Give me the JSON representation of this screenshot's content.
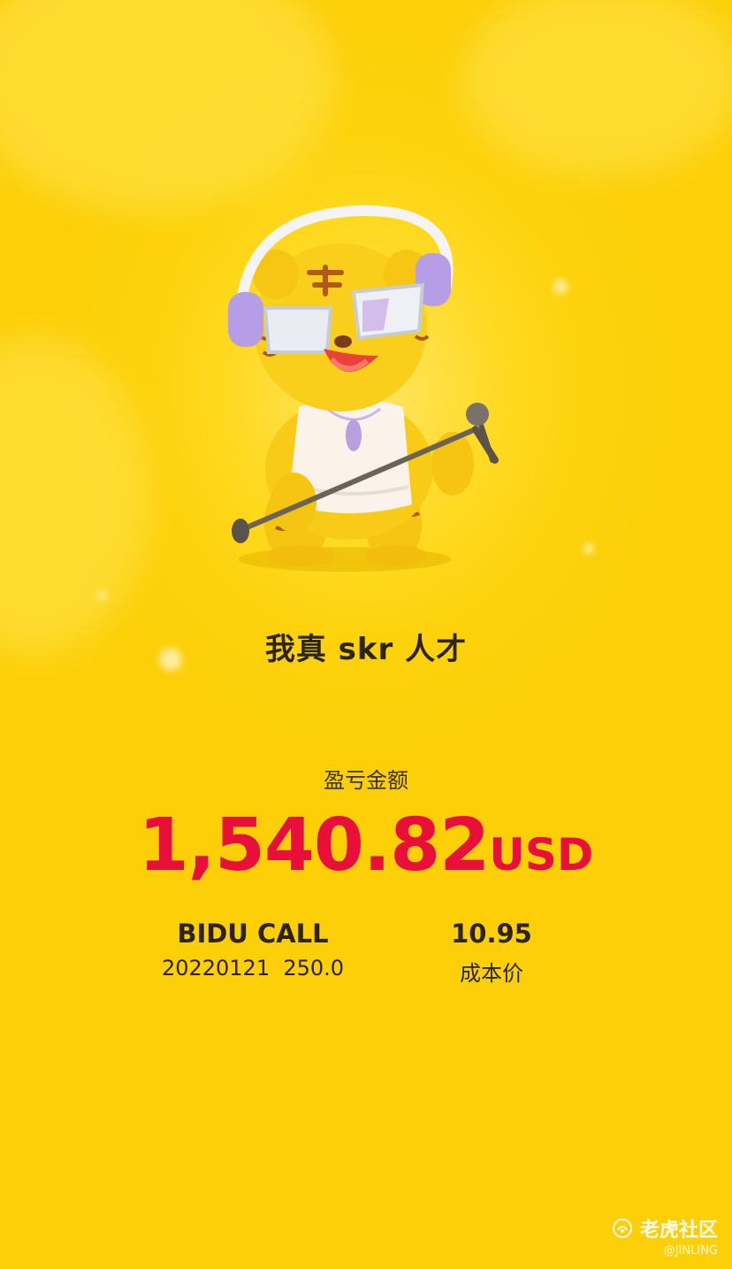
{
  "background": {
    "color": "#fdd20c"
  },
  "mascot": {
    "icon": "tiger-mascot-singing-icon"
  },
  "tagline": "我真 skr 人才",
  "profit_loss": {
    "label": "盈亏金额",
    "amount": "1,540.82",
    "currency": "USD",
    "color": "#e8103a"
  },
  "position": {
    "symbol": "BIDU CALL",
    "detail": "20220121  250.0",
    "cost_value": "10.95",
    "cost_label": "成本价"
  },
  "watermark": {
    "brand": "老虎社区",
    "user": "@JINLING",
    "icon": "tiger-community-logo-icon"
  }
}
